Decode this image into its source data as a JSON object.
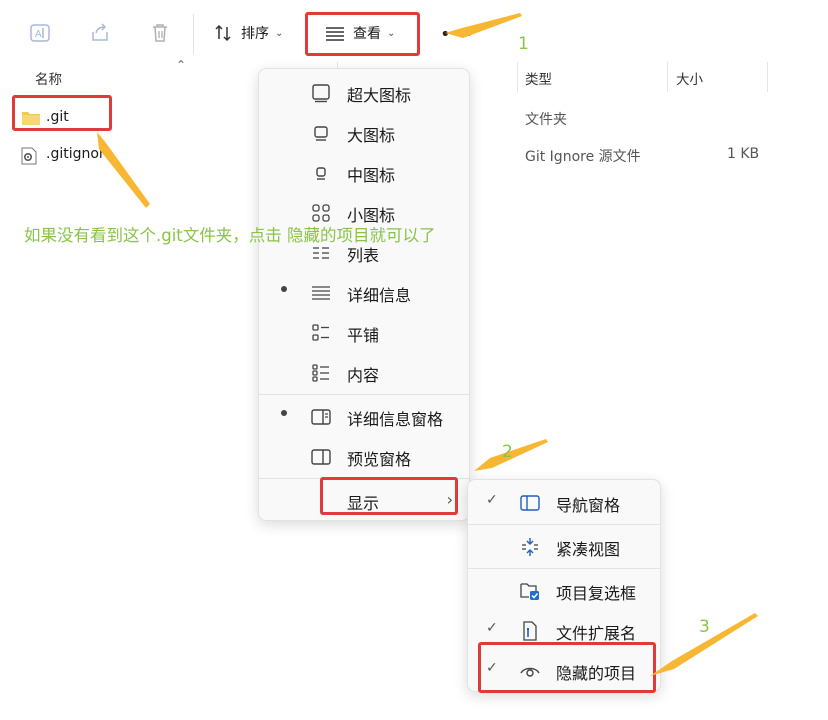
{
  "toolbar": {
    "sort_label": "排序",
    "view_label": "查看",
    "more_label": "•••"
  },
  "columns": {
    "name": "名称",
    "type": "类型",
    "size": "大小"
  },
  "files": [
    {
      "name": ".git",
      "type": "文件夹",
      "size": ""
    },
    {
      "name": ".gitignore",
      "type": "Git Ignore 源文件",
      "size": "1 KB"
    }
  ],
  "annotation": {
    "note": "如果没有看到这个.git文件夹，点击 隐藏的项目就可以了",
    "step1": "1",
    "step2": "2",
    "step3": "3"
  },
  "view_menu": {
    "items": [
      {
        "label": "超大图标",
        "icon": "extra-large-icons-icon",
        "selected": false
      },
      {
        "label": "大图标",
        "icon": "large-icons-icon",
        "selected": false
      },
      {
        "label": "中图标",
        "icon": "medium-icons-icon",
        "selected": false
      },
      {
        "label": "小图标",
        "icon": "small-icons-icon",
        "selected": false
      },
      {
        "label": "列表",
        "icon": "list-icon",
        "selected": false
      },
      {
        "label": "详细信息",
        "icon": "details-icon",
        "selected": true
      },
      {
        "label": "平铺",
        "icon": "tiles-icon",
        "selected": false
      },
      {
        "label": "内容",
        "icon": "content-icon",
        "selected": false
      }
    ],
    "panes": [
      {
        "label": "详细信息窗格",
        "icon": "details-pane-icon",
        "selected": true
      },
      {
        "label": "预览窗格",
        "icon": "preview-pane-icon",
        "selected": false
      }
    ],
    "show_label": "显示"
  },
  "show_menu": {
    "items": [
      {
        "label": "导航窗格",
        "icon": "navigation-pane-icon",
        "checked": true
      },
      {
        "label": "紧凑视图",
        "icon": "compact-view-icon",
        "checked": false
      },
      {
        "label": "项目复选框",
        "icon": "item-checkboxes-icon",
        "checked": false
      },
      {
        "label": "文件扩展名",
        "icon": "file-extensions-icon",
        "checked": true
      },
      {
        "label": "隐藏的项目",
        "icon": "hidden-items-icon",
        "checked": true
      }
    ]
  },
  "colors": {
    "highlight": "#e03a3a",
    "annotation_text": "#8bc34a",
    "arrow": "#f7b733",
    "folder": "#f2c94c"
  }
}
